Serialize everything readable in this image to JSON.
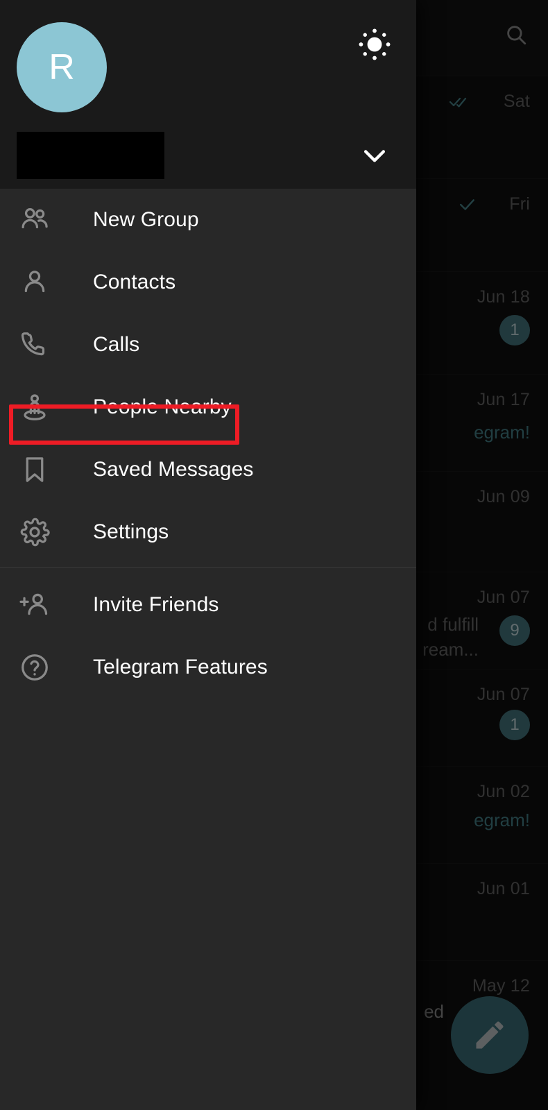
{
  "app": {
    "name": "Telegram",
    "theme": "dark"
  },
  "colors": {
    "drawer_bg": "#282828",
    "drawer_header_bg": "#1a1a1a",
    "avatar_bg": "#8cc6d4",
    "accent_teal": "#4a7f88",
    "fab_bg": "#3f7680",
    "highlight_red": "#ee1c25",
    "label_white": "#ffffff",
    "icon_grey": "#8a8a8a"
  },
  "drawer": {
    "avatar": {
      "initial": "R",
      "name": "avatar"
    },
    "theme_toggle_icon": "sun-icon",
    "account_name": "",
    "account_name_redacted": true,
    "expand_icon": "chevron-down-icon",
    "menu_primary": [
      {
        "label": "New Group",
        "icon": "group-icon"
      },
      {
        "label": "Contacts",
        "icon": "person-icon"
      },
      {
        "label": "Calls",
        "icon": "phone-icon"
      },
      {
        "label": "People Nearby",
        "icon": "people-nearby-icon",
        "highlighted": true
      },
      {
        "label": "Saved Messages",
        "icon": "bookmark-icon"
      },
      {
        "label": "Settings",
        "icon": "gear-icon"
      }
    ],
    "menu_secondary": [
      {
        "label": "Invite Friends",
        "icon": "person-add-icon"
      },
      {
        "label": "Telegram Features",
        "icon": "question-circle-icon"
      }
    ]
  },
  "chat_list": {
    "search_icon": "search-icon",
    "compose_fab_icon": "pencil-icon",
    "rows": [
      {
        "time": "Sat",
        "status": "double-check-icon",
        "snippet": "",
        "badge": ""
      },
      {
        "time": "Fri",
        "status": "single-check-icon",
        "snippet": "",
        "badge": ""
      },
      {
        "time": "Jun 18",
        "status": "",
        "snippet": "",
        "badge": "1"
      },
      {
        "time": "Jun 17",
        "status": "",
        "snippet": "egram!",
        "badge": ""
      },
      {
        "time": "Jun 09",
        "status": "",
        "snippet": "",
        "badge": ""
      },
      {
        "time": "Jun 07",
        "status": "",
        "snippet": "d fulfill",
        "snippet2": "ream...",
        "badge": "9"
      },
      {
        "time": "Jun 07",
        "status": "",
        "snippet": "",
        "badge": "1"
      },
      {
        "time": "Jun 02",
        "status": "",
        "snippet": "egram!",
        "badge": ""
      },
      {
        "time": "Jun 01",
        "status": "",
        "snippet": "",
        "badge": ""
      },
      {
        "time": "May 12",
        "status": "",
        "snippet": "ed",
        "badge": ""
      }
    ]
  }
}
